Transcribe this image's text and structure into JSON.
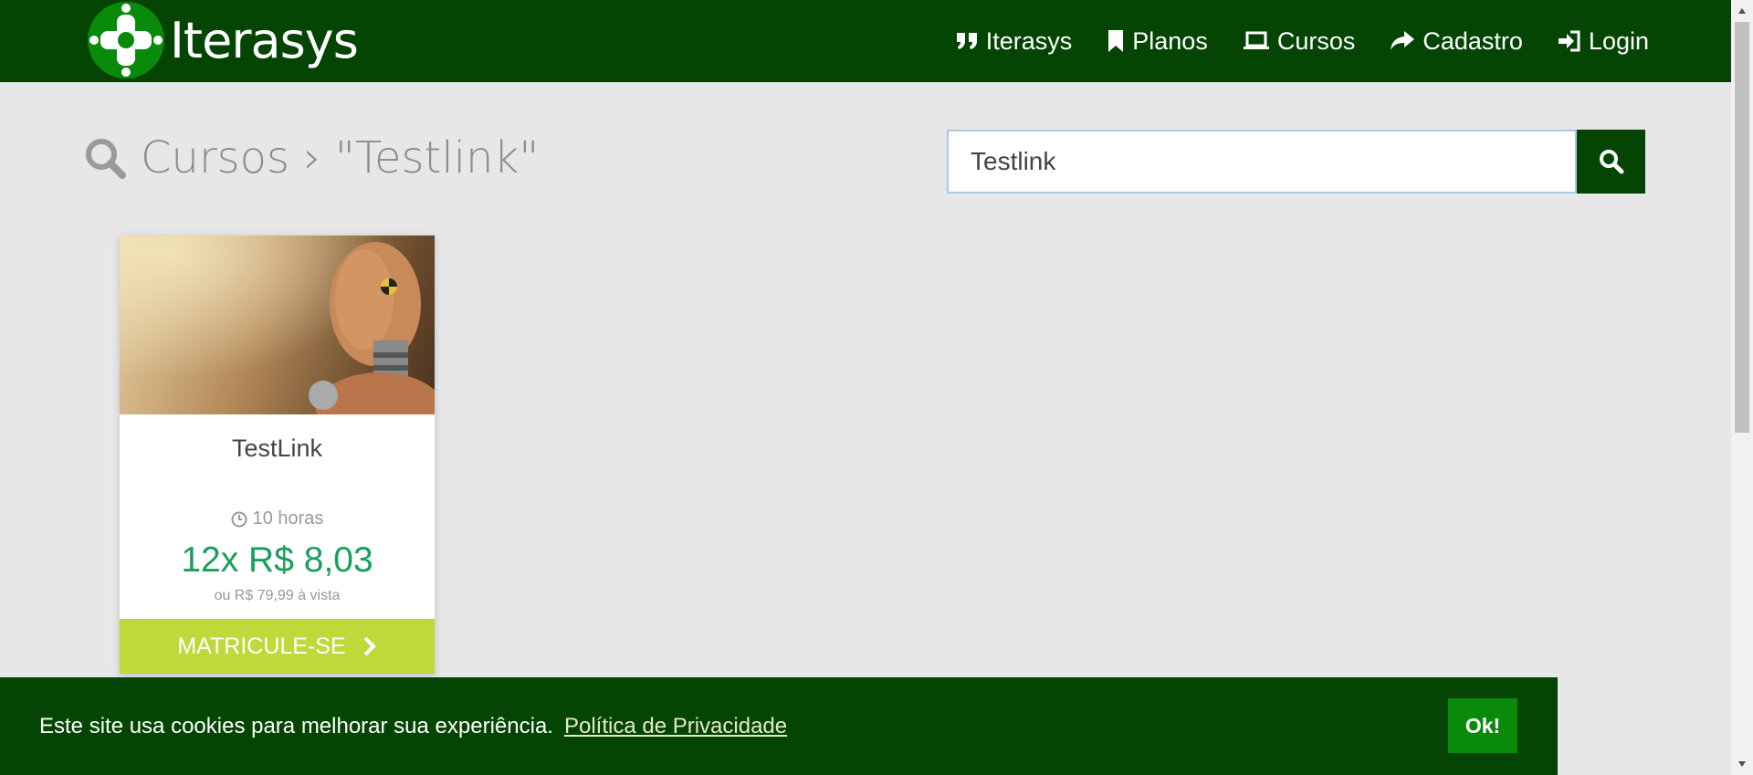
{
  "brand": {
    "name": "Iterasys"
  },
  "nav": {
    "items": [
      {
        "label": "Iterasys",
        "icon": "quote-icon"
      },
      {
        "label": "Planos",
        "icon": "bookmark-icon"
      },
      {
        "label": "Cursos",
        "icon": "laptop-icon"
      },
      {
        "label": "Cadastro",
        "icon": "share-icon"
      },
      {
        "label": "Login",
        "icon": "sign-in-icon"
      }
    ]
  },
  "page": {
    "title": "Cursos › \"Testlink\""
  },
  "search": {
    "value": "Testlink",
    "button_icon": "search-icon"
  },
  "course": {
    "title": "TestLink",
    "hours": "10 horas",
    "installments": "12x R$ 8,03",
    "full_price": "ou R$ 79,99 à vista",
    "enroll_label": "MATRICULE-SE"
  },
  "cookie": {
    "text": "Este site usa cookies para melhorar sua experiência.",
    "link_label": "Política de Privacidade",
    "ok_label": "Ok!"
  },
  "colors": {
    "primary": "#044504",
    "accent": "#0a8a0a",
    "enroll": "#bfd83a",
    "price": "#18a05a"
  }
}
